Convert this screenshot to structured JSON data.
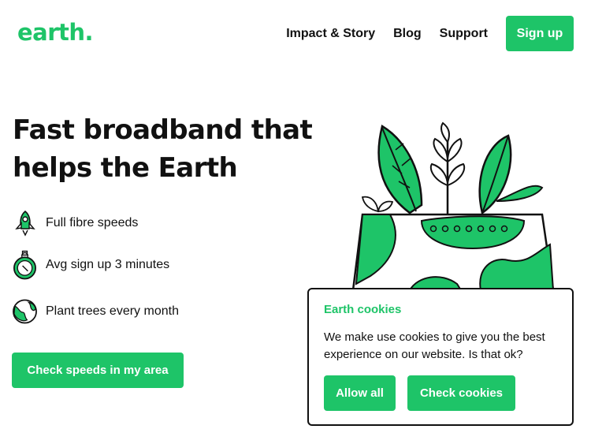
{
  "header": {
    "logo": "earth.",
    "nav": [
      "Impact & Story",
      "Blog",
      "Support"
    ],
    "signup": "Sign up"
  },
  "hero": {
    "title": "Fast broadband that helps the Earth",
    "features": [
      {
        "icon": "rocket-icon",
        "text": "Full fibre speeds"
      },
      {
        "icon": "stopwatch-icon",
        "text": "Avg sign up 3 minutes"
      },
      {
        "icon": "globe-icon",
        "text": "Plant trees every month"
      }
    ],
    "cta": "Check speeds in my area"
  },
  "cookie": {
    "title": "Earth cookies",
    "text": "We make use cookies to give you the best experience on our website. Is that ok?",
    "allow": "Allow all",
    "check": "Check cookies"
  },
  "colors": {
    "accent": "#1ec468",
    "text": "#111111"
  }
}
